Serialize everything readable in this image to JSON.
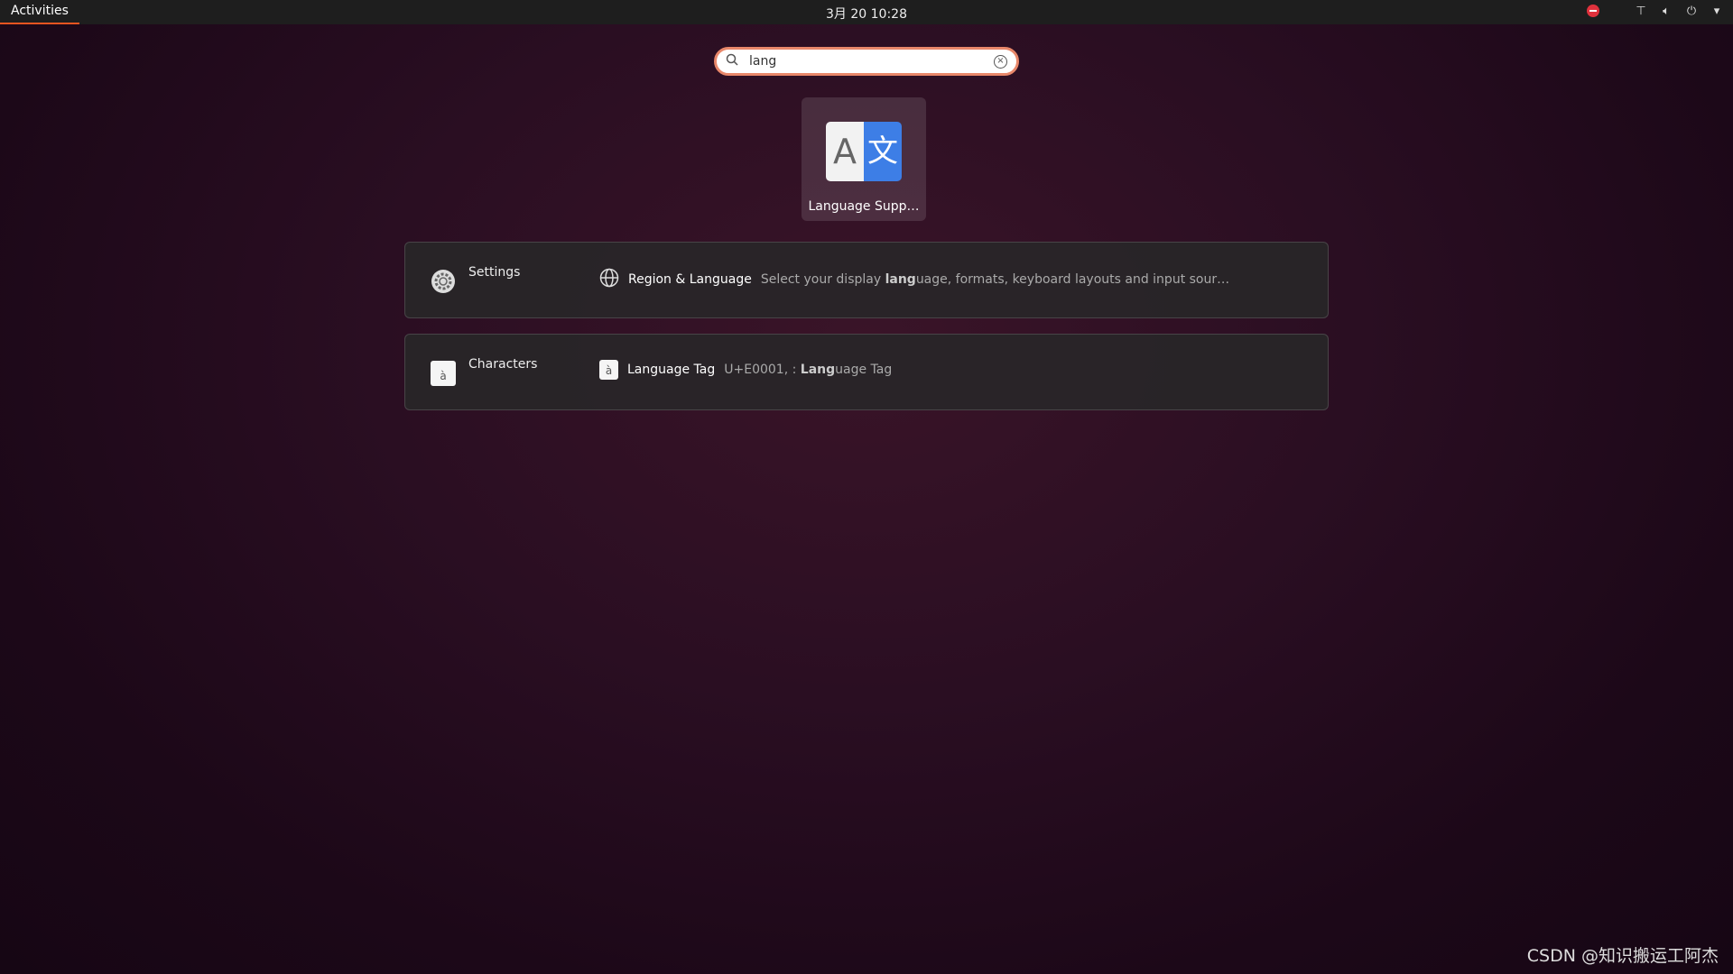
{
  "topbar": {
    "activities": "Activities",
    "clock": "3月 20  10:28",
    "tray_icons": [
      "do-not-disturb-icon",
      "network-icon",
      "volume-icon",
      "power-icon",
      "dropdown-arrow-icon"
    ]
  },
  "search": {
    "value": "lang",
    "icon": "search-icon",
    "clear_icon": "clear-icon"
  },
  "apps": [
    {
      "label": "Language Supp…",
      "icon": "language-support-icon",
      "glyph_a": "A",
      "glyph_b": "文"
    }
  ],
  "results": [
    {
      "provider": "Settings",
      "provider_icon": "gear-icon",
      "title": "Region & Language",
      "icon": "globe-icon",
      "desc_pre": "Select your display ",
      "desc_bold": "lang",
      "desc_post": "uage, formats, keyboard layouts and input sour…"
    },
    {
      "provider": "Characters",
      "provider_icon": "characters-icon",
      "provider_glyph": "à",
      "title": "Language Tag",
      "icon": "character-icon",
      "glyph": "à",
      "desc_pre": "U+E0001, : ",
      "desc_bold": "Lang",
      "desc_post": "uage Tag"
    }
  ],
  "watermark": "CSDN @知识搬运工阿杰",
  "colors": {
    "accent": "#e95420",
    "search_border": "#e8876a",
    "topbar": "#1e1e1e"
  }
}
